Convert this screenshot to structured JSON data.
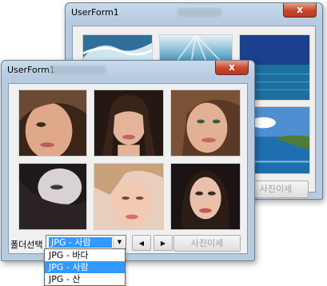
{
  "back_window": {
    "title": "UserForm1",
    "close_label": "x",
    "detail_button": "사진이세",
    "tiles": [
      {
        "name": "wave-photo"
      },
      {
        "name": "underwater-light-photo"
      },
      {
        "name": "ocean-horizon-photo"
      },
      {
        "name": "coast-photo"
      }
    ]
  },
  "front_window": {
    "title": "UserForm1",
    "close_label": "x",
    "folder_label": "폴더선택",
    "combo": {
      "selected": "JPG - 사람",
      "options": [
        "JPG - 바다",
        "JPG - 사람",
        "JPG - 산"
      ],
      "highlighted_index": 1
    },
    "prev_icon": "◀",
    "next_icon": "▶",
    "detail_button": "사진이세",
    "tiles": [
      {
        "name": "portrait-1"
      },
      {
        "name": "portrait-2"
      },
      {
        "name": "portrait-3"
      },
      {
        "name": "portrait-4"
      },
      {
        "name": "portrait-5"
      },
      {
        "name": "portrait-6"
      }
    ]
  },
  "colors": {
    "window_frame": "#b6cbe0",
    "client": "#f0f0f0",
    "selection": "#3399ff",
    "close_button": "#c7452c"
  }
}
